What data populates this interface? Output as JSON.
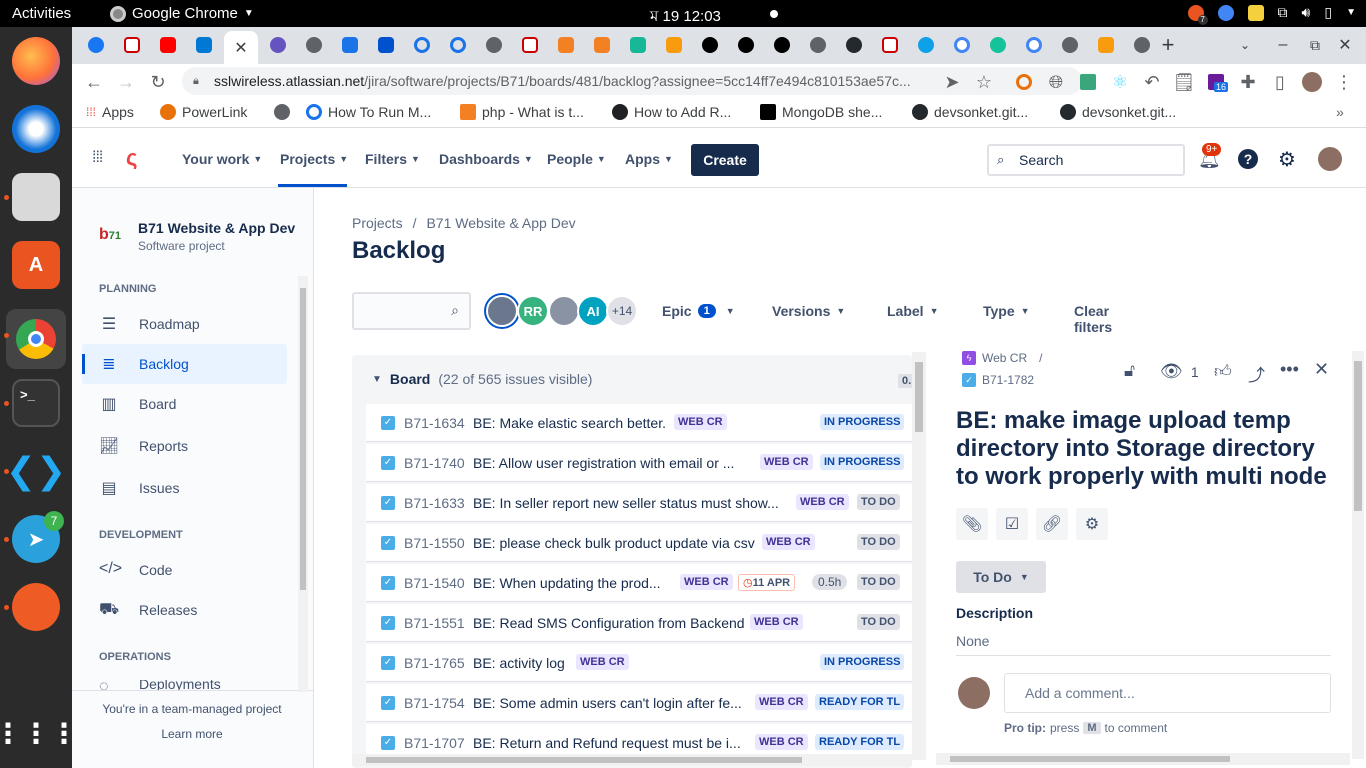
{
  "os": {
    "activities": "Activities",
    "app_name": "Google Chrome",
    "clock": "ম 19  12:03",
    "dock_badge_telegram": "7",
    "tray_badge": "7"
  },
  "browser": {
    "url_host": "sslwireless.atlassian.net",
    "url_path": "/jira/software/projects/B71/boards/481/backlog?assignee=5cc14ff7e494c810153ae57c...",
    "ext_badge": "16",
    "bookmarks": [
      {
        "label": "Apps"
      },
      {
        "label": "PowerLink"
      },
      {
        "label": ""
      },
      {
        "label": "How To Run M..."
      },
      {
        "label": "php - What is t..."
      },
      {
        "label": "How to Add R..."
      },
      {
        "label": "MongoDB she..."
      },
      {
        "label": "devsonket.git..."
      },
      {
        "label": "devsonket.git..."
      }
    ]
  },
  "jira_header": {
    "nav": [
      "Your work",
      "Projects",
      "Filters",
      "Dashboards",
      "People",
      "Apps"
    ],
    "create": "Create",
    "search_placeholder": "Search",
    "notif_badge": "9+"
  },
  "sidebar": {
    "project_name": "B71 Website & App Dev",
    "project_type": "Software project",
    "planning_heading": "PLANNING",
    "planning_items": [
      "Roadmap",
      "Backlog",
      "Board",
      "Reports",
      "Issues"
    ],
    "development_heading": "DEVELOPMENT",
    "development_items": [
      "Code",
      "Releases"
    ],
    "operations_heading": "OPERATIONS",
    "operations_items": [
      "Deployments"
    ],
    "footer_text": "You're in a team-managed project",
    "learn_more": "Learn more"
  },
  "main": {
    "breadcrumb_projects": "Projects",
    "breadcrumb_sep": "/",
    "breadcrumb_project": "B71 Website & App Dev",
    "title": "Backlog",
    "avatars": [
      {
        "initials": "",
        "color": "#6b778c"
      },
      {
        "initials": "RR",
        "color": "#36b37e"
      },
      {
        "initials": "",
        "color": "#8993a4"
      },
      {
        "initials": "AI",
        "color": "#00a3bf"
      },
      {
        "initials": "+14",
        "color": "#dfe1e6"
      }
    ],
    "filters": {
      "epic": "Epic",
      "epic_count": "1",
      "versions": "Versions",
      "label": "Label",
      "type": "Type",
      "clear": "Clear filters"
    },
    "board_title": "Board",
    "board_count": "(22 of 565 issues visible)",
    "board_points": "0.",
    "issues": [
      {
        "key": "B71-1634",
        "summary": "BE: Make elastic search better.",
        "epic": "WEB CR",
        "status": "IN PROGRESS",
        "status_kind": "prog"
      },
      {
        "key": "B71-1740",
        "summary": "BE: Allow user registration with email or ...",
        "epic": "WEB CR",
        "status": "IN PROGRESS",
        "status_kind": "prog"
      },
      {
        "key": "B71-1633",
        "summary": "BE: In seller report new seller status must show...",
        "epic": "WEB CR",
        "status": "TO DO",
        "status_kind": "todo"
      },
      {
        "key": "B71-1550",
        "summary": "BE: please check bulk product update via csv",
        "epic": "WEB CR",
        "status": "TO DO",
        "status_kind": "todo"
      },
      {
        "key": "B71-1540",
        "summary": "BE: When updating the prod...",
        "epic": "WEB CR",
        "status": "TO DO",
        "status_kind": "todo",
        "date": "11 APR",
        "estimate": "0.5h"
      },
      {
        "key": "B71-1551",
        "summary": "BE: Read SMS Configuration from Backend",
        "epic": "WEB CR",
        "status": "TO DO",
        "status_kind": "todo"
      },
      {
        "key": "B71-1765",
        "summary": "BE: activity log",
        "epic": "WEB CR",
        "status": "IN PROGRESS",
        "status_kind": "prog"
      },
      {
        "key": "B71-1754",
        "summary": "BE: Some admin users can't login after fe...",
        "epic": "WEB CR",
        "status": "READY FOR TL",
        "status_kind": "tl"
      },
      {
        "key": "B71-1707",
        "summary": "BE: Return and Refund request must be i...",
        "epic": "WEB CR",
        "status": "READY FOR TL",
        "status_kind": "tl"
      }
    ]
  },
  "detail": {
    "parent_epic": "Web CR",
    "parent_sep": "/",
    "issue_key": "B71-1782",
    "watch_count": "1",
    "title": "BE: make image upload temp directory into Storage directory to work properly with multi node",
    "status_button": "To Do",
    "description_label": "Description",
    "description_value": "None",
    "comment_placeholder": "Add a comment...",
    "pro_tip_prefix": "Pro tip:",
    "pro_tip_press": "press",
    "pro_tip_key": "M",
    "pro_tip_suffix": "to comment"
  }
}
